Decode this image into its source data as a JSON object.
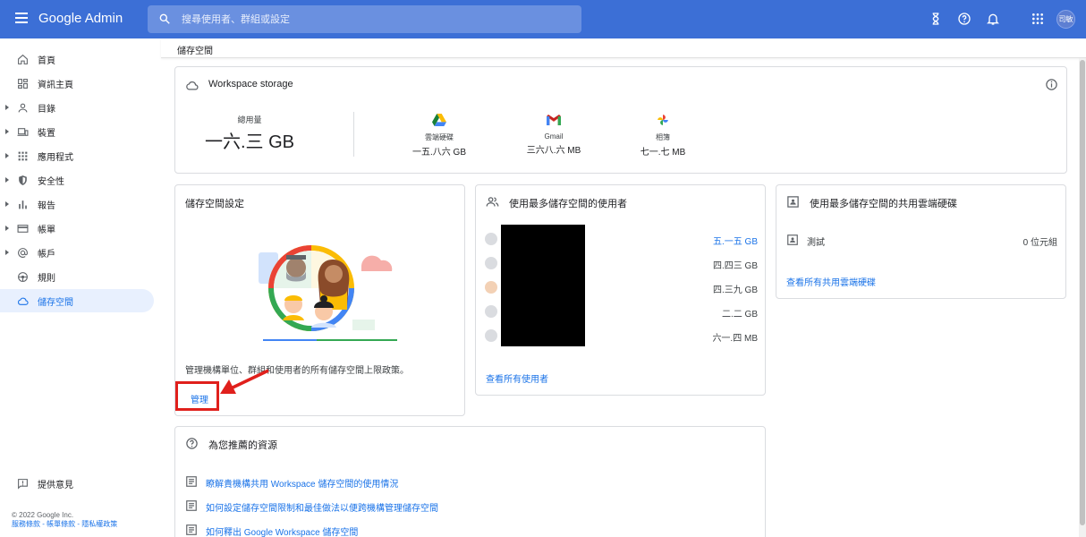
{
  "app": {
    "brand": "Google Admin",
    "avatar_text": "司敏"
  },
  "search": {
    "placeholder": "搜尋使用者、群組或設定"
  },
  "sidebar": {
    "items": [
      {
        "label": "首頁",
        "icon": "home-icon",
        "caret": false
      },
      {
        "label": "資訊主頁",
        "icon": "dashboard-icon",
        "caret": false
      },
      {
        "label": "目錄",
        "icon": "person-icon",
        "caret": true
      },
      {
        "label": "裝置",
        "icon": "devices-icon",
        "caret": true
      },
      {
        "label": "應用程式",
        "icon": "apps-grid-icon",
        "caret": true
      },
      {
        "label": "安全性",
        "icon": "shield-icon",
        "caret": true
      },
      {
        "label": "報告",
        "icon": "bar-chart-icon",
        "caret": true
      },
      {
        "label": "帳單",
        "icon": "credit-card-icon",
        "caret": true
      },
      {
        "label": "帳戶",
        "icon": "at-sign-icon",
        "caret": true
      },
      {
        "label": "規則",
        "icon": "rules-icon",
        "caret": false
      },
      {
        "label": "儲存空間",
        "icon": "cloud-icon",
        "caret": false,
        "active": true
      }
    ],
    "feedback": "提供意見",
    "copyright": "© 2022 Google Inc.",
    "footer_links": "服務條款 - 帳單條款 - 隱私權政策"
  },
  "breadcrumb": "儲存空間",
  "workspace_storage": {
    "title": "Workspace storage",
    "total_label": "總用量",
    "total_value": "一六.三 GB",
    "services": [
      {
        "name": "雲端硬碟",
        "value": "一五.八六 GB",
        "icon": "drive-icon"
      },
      {
        "name": "Gmail",
        "value": "三六八.六 MB",
        "icon": "gmail-icon"
      },
      {
        "name": "相簿",
        "value": "七一.七 MB",
        "icon": "photos-icon"
      }
    ]
  },
  "storage_settings": {
    "title": "儲存空間設定",
    "description": "管理機構單位、群組和使用者的所有儲存空間上限政策。",
    "manage_label": "管理"
  },
  "top_users": {
    "title": "使用最多儲存空間的使用者",
    "rows": [
      {
        "value": "五.一五 GB",
        "highlight": true
      },
      {
        "value": "四.四三 GB",
        "highlight": false
      },
      {
        "value": "四.三九 GB",
        "highlight": false
      },
      {
        "value": "二.二 GB",
        "highlight": false
      },
      {
        "value": "六一.四 MB",
        "highlight": false
      }
    ],
    "view_all": "查看所有使用者"
  },
  "top_shared_drives": {
    "title": "使用最多儲存空間的共用雲端硬碟",
    "rows": [
      {
        "name": "測試",
        "value": "0 位元組"
      }
    ],
    "view_all": "查看所有共用雲端硬碟"
  },
  "resources": {
    "title": "為您推薦的資源",
    "items": [
      "瞭解貴機構共用 Workspace 儲存空間的使用情況",
      "如何設定儲存空間限制和最佳做法以便跨機構管理儲存空間",
      "如何釋出 Google Workspace 儲存空間"
    ]
  },
  "colors": {
    "topbar": "#3c6fd6",
    "link": "#1a73e8",
    "highlight_box": "#e0201c"
  }
}
